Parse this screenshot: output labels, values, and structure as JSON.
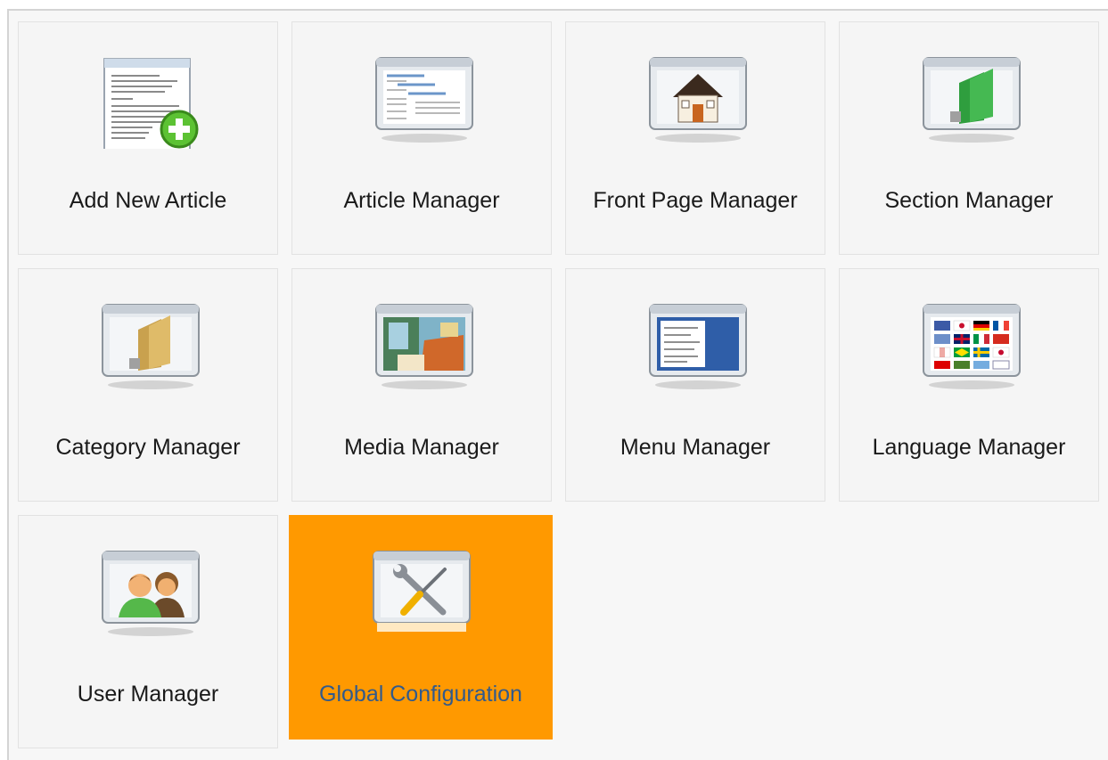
{
  "control_panel": {
    "items": [
      {
        "label": "Add New Article",
        "icon": "add-article-icon"
      },
      {
        "label": "Article Manager",
        "icon": "article-manager-icon"
      },
      {
        "label": "Front Page Manager",
        "icon": "front-page-icon"
      },
      {
        "label": "Section Manager",
        "icon": "section-folder-icon"
      },
      {
        "label": "Category Manager",
        "icon": "category-folder-icon"
      },
      {
        "label": "Media Manager",
        "icon": "media-icon"
      },
      {
        "label": "Menu Manager",
        "icon": "menu-icon"
      },
      {
        "label": "Language Manager",
        "icon": "language-flags-icon"
      },
      {
        "label": "User Manager",
        "icon": "users-icon"
      },
      {
        "label": "Global Configuration",
        "icon": "tools-icon",
        "active": true
      }
    ]
  },
  "colors": {
    "active_tile": "#ff9900",
    "active_label": "#315a8c",
    "tile_background": "#f5f5f5"
  }
}
